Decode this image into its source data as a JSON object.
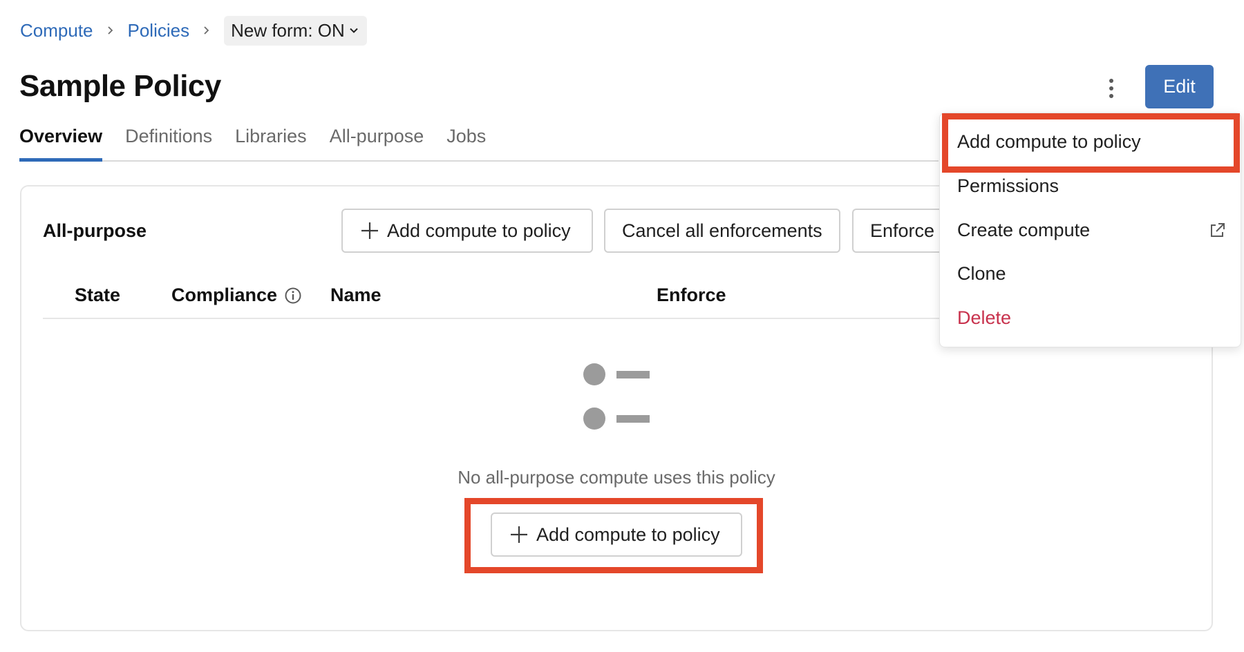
{
  "breadcrumb": {
    "items": [
      "Compute",
      "Policies"
    ],
    "form_toggle": "New form: ON"
  },
  "page": {
    "title": "Sample Policy",
    "edit_label": "Edit"
  },
  "tabs": [
    {
      "label": "Overview",
      "active": true
    },
    {
      "label": "Definitions",
      "active": false
    },
    {
      "label": "Libraries",
      "active": false
    },
    {
      "label": "All-purpose",
      "active": false
    },
    {
      "label": "Jobs",
      "active": false
    }
  ],
  "section": {
    "title": "All-purpose",
    "add_label": "Add compute to policy",
    "cancel_label": "Cancel all enforcements",
    "enforce_label": "Enforce"
  },
  "table": {
    "columns": [
      "State",
      "Compliance",
      "Name",
      "Enforce"
    ]
  },
  "empty_state": {
    "message": "No all-purpose compute uses this policy",
    "add_label": "Add compute to policy"
  },
  "menu": {
    "items": [
      {
        "label": "Add compute to policy",
        "danger": false
      },
      {
        "label": "Permissions",
        "danger": false
      },
      {
        "label": "Create compute",
        "danger": false,
        "icon": "external-link-icon"
      },
      {
        "label": "Clone",
        "danger": false
      },
      {
        "label": "Delete",
        "danger": true
      }
    ]
  },
  "colors": {
    "accent": "#3f71b7",
    "link": "#2e6ab8",
    "highlight": "#e4472a",
    "danger": "#c8324d"
  }
}
